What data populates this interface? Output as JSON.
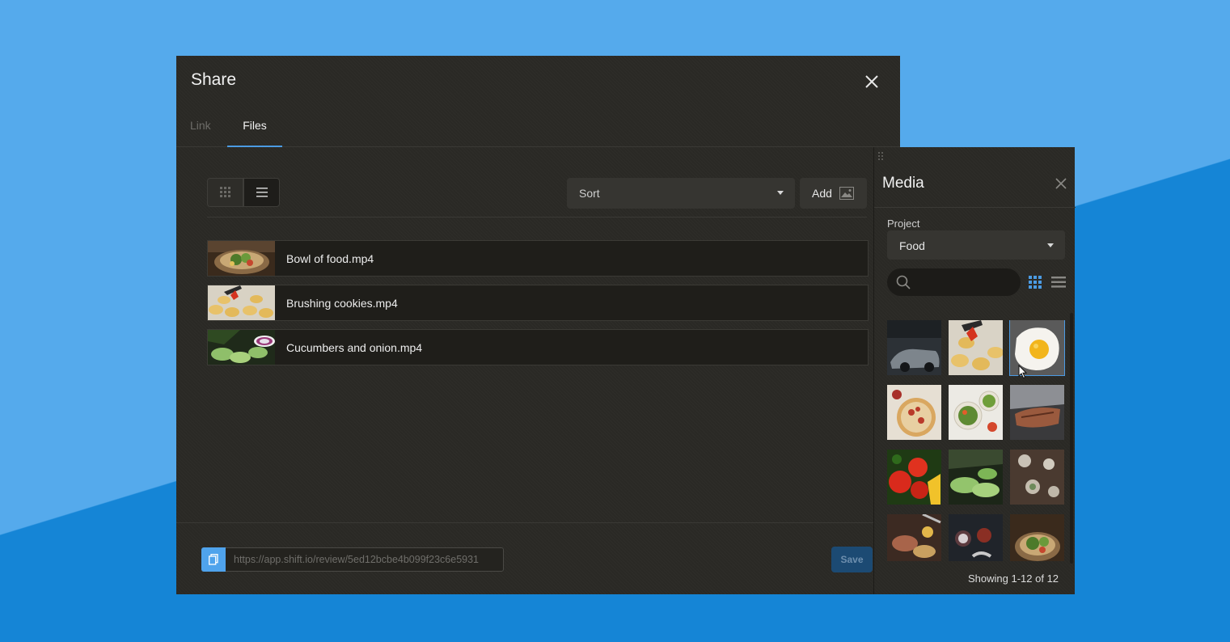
{
  "share": {
    "title": "Share",
    "tabs": [
      {
        "label": "Link",
        "active": false
      },
      {
        "label": "Files",
        "active": true
      }
    ],
    "sort_label": "Sort",
    "add_label": "Add",
    "files": [
      {
        "name": "Bowl of food.mp4"
      },
      {
        "name": "Brushing cookies.mp4"
      },
      {
        "name": "Cucumbers and onion.mp4"
      }
    ],
    "url": "https://app.shift.io/review/5ed12bcbe4b099f23c6e5931",
    "save_label": "Save"
  },
  "media": {
    "title": "Media",
    "project_label": "Project",
    "project_value": "Food",
    "search_placeholder": "",
    "showing": "Showing 1-12 of 12",
    "selected_index": 2
  },
  "colors": {
    "accent": "#4b9be3",
    "dialog_bg": "#2a2925",
    "background_light": "#55aaec",
    "background_dark": "#1585d6"
  }
}
